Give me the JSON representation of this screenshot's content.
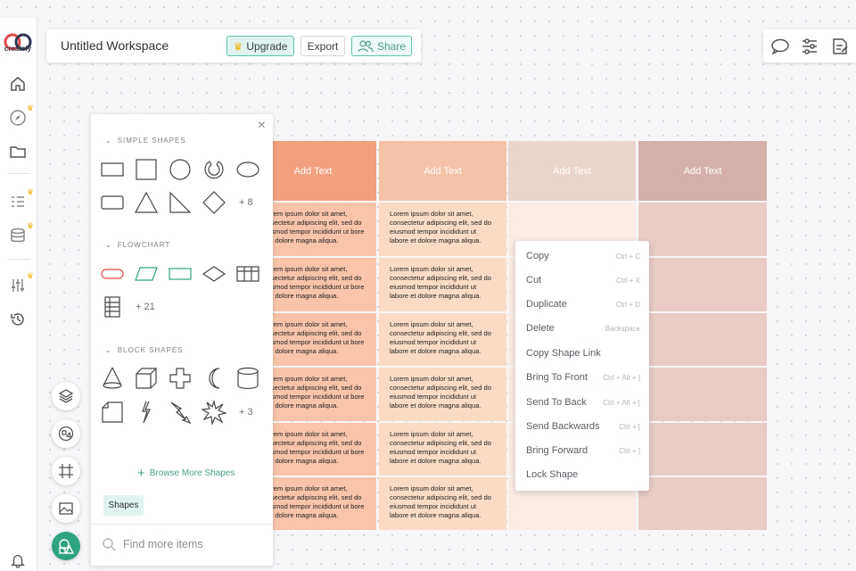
{
  "app": {
    "logo_text": "creately"
  },
  "topbar": {
    "title": "Untitled Workspace",
    "upgrade_label": "Upgrade",
    "export_label": "Export",
    "share_label": "Share"
  },
  "left_rail": {
    "items": [
      {
        "icon": "home-icon",
        "premium": false
      },
      {
        "icon": "compass-icon",
        "premium": true
      },
      {
        "icon": "folder-icon",
        "premium": false
      },
      {
        "icon": "list-icon",
        "premium": true
      },
      {
        "icon": "database-icon",
        "premium": true
      },
      {
        "icon": "sliders-icon",
        "premium": true
      },
      {
        "icon": "history-icon",
        "premium": false
      },
      {
        "icon": "bell-icon",
        "premium": false
      }
    ]
  },
  "right_toolbar": {
    "icons": [
      "comment-icon",
      "settings-sliders-icon",
      "notes-icon"
    ]
  },
  "shapes_panel": {
    "sections": [
      {
        "title": "SIMPLE SHAPES",
        "more": "+ 8"
      },
      {
        "title": "FLOWCHART",
        "more": "+ 21"
      },
      {
        "title": "BLOCK SHAPES",
        "more": "+ 3"
      }
    ],
    "browse_more": "Browse More Shapes",
    "tab_label": "Shapes",
    "search_placeholder": "Find more items"
  },
  "table": {
    "headers": [
      "Add Text",
      "Add Text",
      "Add Text",
      "Add Text"
    ],
    "lorem": "Lorem ipsum dolor sit amet, consectetur adipiscing elit, sed do eiusmod tempor incididunt ut labore et dolore magna aliqua.",
    "lorem_clipped": "orem ipsum dolor sit amet, ssectetur adipiscing elit, sed do usmod tempor incididunt ut bore et dolore magna aliqua.",
    "colors": {
      "header": [
        "#f3a07e",
        "#f5c2a7",
        "#ebd6cd",
        "#d4b2ab"
      ],
      "body": [
        "#f9c4a8",
        "#fbdac6",
        "#fbebe5",
        "#e9ccc6"
      ]
    }
  },
  "context_menu": {
    "items": [
      {
        "label": "Copy",
        "shortcut": "Ctrl + C"
      },
      {
        "label": "Cut",
        "shortcut": "Ctrl + X"
      },
      {
        "label": "Duplicate",
        "shortcut": "Ctrl + D"
      },
      {
        "label": "Delete",
        "shortcut": "Backspace"
      },
      {
        "label": "Copy Shape Link",
        "shortcut": ""
      },
      {
        "label": "Bring To Front",
        "shortcut": "Ctrl + Alt + ]"
      },
      {
        "label": "Send To Back",
        "shortcut": "Ctrl + Alt + ["
      },
      {
        "label": "Send Backwards",
        "shortcut": "Ctrl + ["
      },
      {
        "label": "Bring Forward",
        "shortcut": "Ctrl + ]"
      },
      {
        "label": "Lock Shape",
        "shortcut": ""
      }
    ]
  },
  "fabs": [
    "layers-icon",
    "shapes-library-icon",
    "frame-icon",
    "image-icon",
    "shapes-active-icon"
  ],
  "accent_color": "#2fa37f"
}
